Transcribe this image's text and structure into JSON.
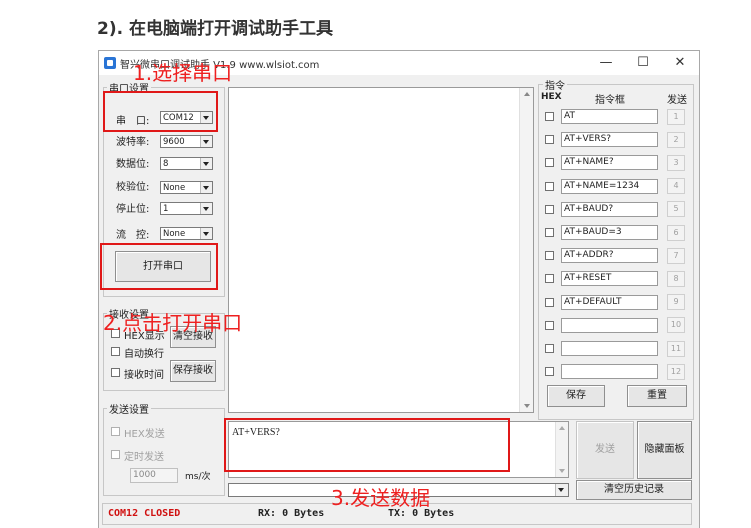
{
  "page": {
    "heading": "2). 在电脑端打开调试助手工具"
  },
  "window": {
    "title": "智兴微串口调试助手 V1.9   www.wlsiot.com",
    "controls": {
      "minimize": "—",
      "maximize": "☐",
      "close": "✕"
    }
  },
  "serial_settings": {
    "group_label": "串口设置",
    "port": {
      "label": "串　口:",
      "value": "COM12"
    },
    "baud": {
      "label": "波特率:",
      "value": "9600"
    },
    "data_bits": {
      "label": "数据位:",
      "value": "8"
    },
    "parity": {
      "label": "校验位:",
      "value": "None"
    },
    "stop_bits": {
      "label": "停止位:",
      "value": "1"
    },
    "flow": {
      "label": "流　控:",
      "value": "None"
    },
    "open_button": "打开串口"
  },
  "receive_settings": {
    "group_label": "接收设置",
    "hex_label": "HEX显示",
    "auto_newline_label": "自动换行",
    "recv_time_label": "接收时间",
    "clear_button": "清空接收",
    "save_button": "保存接收"
  },
  "send_settings": {
    "group_label": "发送设置",
    "hex_send_label": "HEX发送",
    "timed_send_label": "定时发送",
    "interval_value": "1000",
    "interval_unit": "ms/次"
  },
  "commands": {
    "group_label": "指令",
    "col_hex": "HEX",
    "col_cmd": "指令框",
    "col_send": "发送",
    "rows": [
      {
        "text": "AT",
        "num": "1"
      },
      {
        "text": "AT+VERS?",
        "num": "2"
      },
      {
        "text": "AT+NAME?",
        "num": "3"
      },
      {
        "text": "AT+NAME=1234",
        "num": "4"
      },
      {
        "text": "AT+BAUD?",
        "num": "5"
      },
      {
        "text": "AT+BAUD=3",
        "num": "6"
      },
      {
        "text": "AT+ADDR?",
        "num": "7"
      },
      {
        "text": "AT+RESET",
        "num": "8"
      },
      {
        "text": "AT+DEFAULT",
        "num": "9"
      },
      {
        "text": "",
        "num": "10"
      },
      {
        "text": "",
        "num": "11"
      },
      {
        "text": "",
        "num": "12"
      }
    ],
    "save_button": "保存",
    "reset_button": "重置"
  },
  "send_area": {
    "text": "AT+VERS?",
    "send_button": "发送",
    "hide_panel_button": "隐藏面板",
    "history_value": "",
    "clear_history_button": "清空历史记录"
  },
  "status": {
    "port_status": "COM12 CLOSED",
    "rx": "RX: 0 Bytes",
    "tx": "TX: 0 Bytes"
  },
  "annotations": {
    "step1": "1.选择串口",
    "step2": "2.点击打开串口",
    "step3": "3.发送数据"
  },
  "colors": {
    "annotation": "#e01818",
    "status_text": "#d01010",
    "icon": "#2a75d6"
  }
}
